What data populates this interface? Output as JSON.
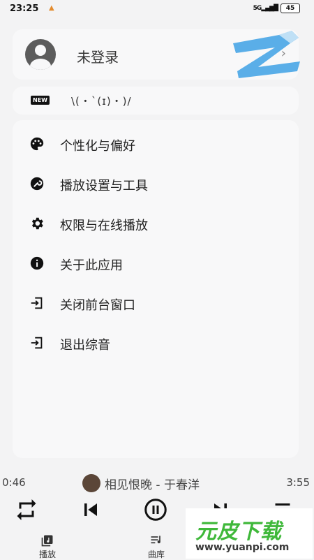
{
  "status_bar": {
    "time": "23:25",
    "signal": "5G",
    "battery": "45"
  },
  "account": {
    "name": "未登录"
  },
  "news": {
    "badge": "NEW",
    "text": "\\(・`(ɪ)・)/"
  },
  "menu": {
    "items": [
      {
        "label": "个性化与偏好",
        "icon": "palette-icon"
      },
      {
        "label": "播放设置与工具",
        "icon": "wrench-icon"
      },
      {
        "label": "权限与在线播放",
        "icon": "gear-icon"
      },
      {
        "label": "关于此应用",
        "icon": "info-icon"
      },
      {
        "label": "关闭前台窗口",
        "icon": "exit-icon"
      },
      {
        "label": "退出综音",
        "icon": "exit-icon"
      }
    ]
  },
  "player": {
    "elapsed": "0:46",
    "duration": "3:55",
    "song_title": "相见恨晚 - 于春洋"
  },
  "tabs": [
    {
      "label": "播放",
      "icon": "now-playing-icon"
    },
    {
      "label": "曲库",
      "icon": "library-icon"
    }
  ],
  "watermark": {
    "brand": "元皮下载",
    "url": "www.yuanpi.com"
  },
  "colors": {
    "background": "#f3f3f4",
    "card": "#f8f8f9",
    "logo_blue": "#5aaee8",
    "watermark_green": "#3fb83a"
  }
}
